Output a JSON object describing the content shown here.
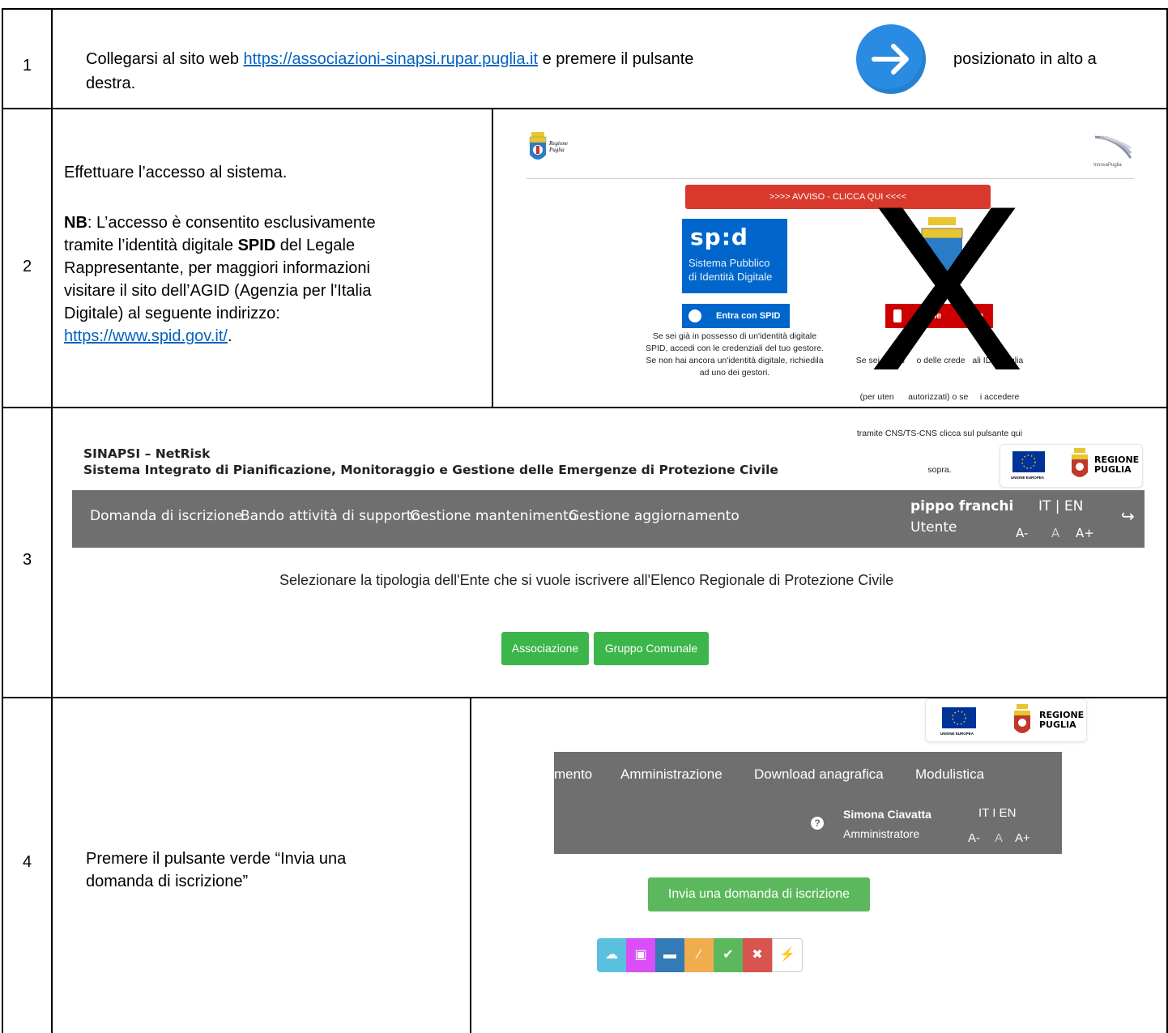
{
  "rows": [
    {
      "num": "1",
      "text_before": "Collegarsi al sito web ",
      "link": "https://associazioni-sinapsi.rupar.puglia.it",
      "text_mid": " e premere il pulsante",
      "text_after": "posizionato in alto a",
      "text_wrap": "destra."
    },
    {
      "num": "2",
      "line1": "Effettuare l’accesso al sistema.",
      "nb_label": "NB",
      "nb_l1": ": L’accesso è consentito esclusivamente",
      "nb_l2a": "tramite l’identità digitale ",
      "spid_bold": "SPID",
      "nb_l2b": " del Legale",
      "nb_l3": "Rappresentante, per maggiori informazioni",
      "nb_l4": "visitare il sito dell’AGID (Agenzia per l'Italia",
      "nb_l5": "Digitale) al seguente indirizzo:",
      "link": "https://www.spid.gov.it/",
      "link_suffix": "."
    },
    {
      "num": "3"
    },
    {
      "num": "4",
      "line1": "Premere il pulsante verde “Invia una",
      "line2": "domanda di iscrizione”"
    }
  ],
  "login_screen": {
    "regione_l1": "Regione",
    "regione_l2": "Puglia",
    "innova": "InnovaPuglia",
    "avviso": ">>>> AVVISO - CLICCA QUI <<<<",
    "spid_logo": "sp:d",
    "spid_sub1": "Sistema Pubblico",
    "spid_sub2": "di Identità Digitale",
    "spid_button": "Entra con SPID",
    "regione_button": "gione",
    "regione_button2": "ia",
    "spid_desc": [
      "Se sei già in possesso di un'identità digitale",
      "SPID, accedi con le credenziali del tuo gestore.",
      "Se non hai ancora un'identità digitale, richiedila",
      "ad uno dei gestori."
    ],
    "idp_desc": [
      "Se sei in pos     o delle crede   ali IDP Puglia",
      "(per uten      autorizzati) o se     i accedere",
      "tramite CNS/TS-CNS clicca sul pulsante qui",
      "sopra."
    ],
    "cross": "X"
  },
  "app_screen": {
    "title1": "SINAPSI – NetRisk",
    "title2": "Sistema Integrato di Pianificazione, Monitoraggio e Gestione delle Emergenze di Protezione Civile",
    "eu_label": "UNIONE EUROPEA",
    "regione": "REGIONE",
    "puglia": "PUGLIA",
    "menu": [
      "Domanda di iscrizione",
      "Bando attività di supporto",
      "Gestione mantenimento",
      "Gestione aggiornamento"
    ],
    "user_name": "pippo franchi",
    "user_role": "Utente",
    "lang": "IT | EN",
    "font_minus": "A-",
    "font_normal": "A",
    "font_plus": "A+",
    "prompt": "Selezionare la tipologia dell'Ente che si vuole iscrivere all'Elenco Regionale di Protezione Civile",
    "btn_associazione": "Associazione",
    "btn_gruppo": "Gruppo Comunale"
  },
  "admin_screen": {
    "eu_label": "UNIONE EUROPEA",
    "regione": "REGIONE",
    "puglia": "PUGLIA",
    "menu": [
      "mento",
      "Amministrazione",
      "Download anagrafica",
      "Modulistica"
    ],
    "user_name": "Simona Ciavatta",
    "user_role": "Amministratore",
    "lang": "IT I EN",
    "font_minus": "A-",
    "font_normal": "A",
    "font_plus": "A+",
    "invia_button": "Invia una domanda di iscrizione",
    "tool_colors": [
      "#5bc0de",
      "#d94ff5",
      "#337ab7",
      "#f0ad4e",
      "#5cb85c",
      "#d9534f",
      "#ffffff"
    ]
  }
}
